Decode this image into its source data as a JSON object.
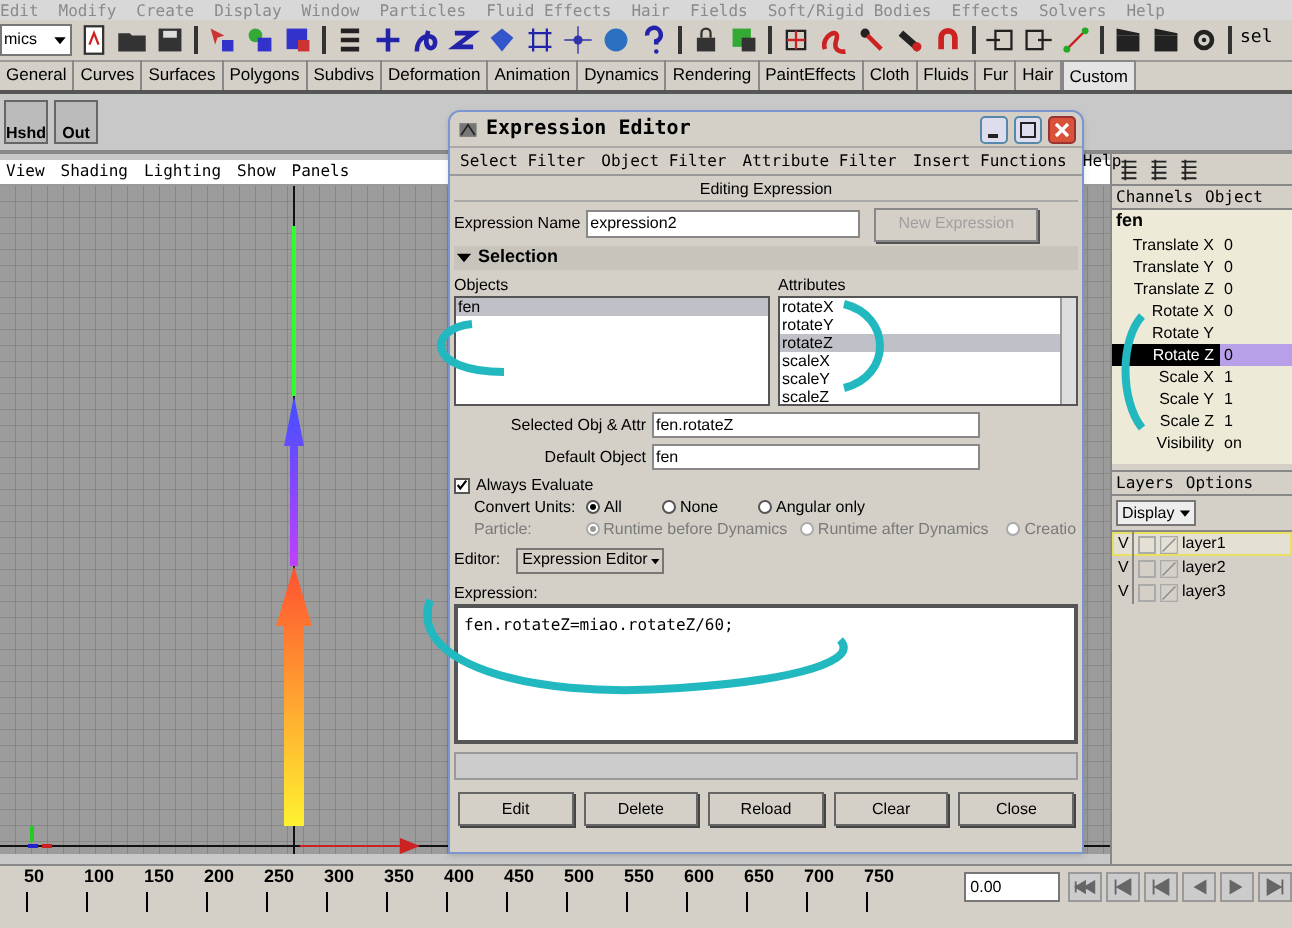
{
  "menu_bar": [
    "Edit",
    "Modify",
    "Create",
    "Display",
    "Window",
    "Particles",
    "Fluid Effects",
    "Hair",
    "Fields",
    "Soft/Rigid Bodies",
    "Effects",
    "Solvers",
    "Help"
  ],
  "toolbar": {
    "mode_dropdown": "mics",
    "selection_label": "sel"
  },
  "shelf": {
    "tabs": [
      {
        "label": "General",
        "selected": false
      },
      {
        "label": "Curves",
        "selected": false
      },
      {
        "label": "Surfaces",
        "selected": false
      },
      {
        "label": "Polygons",
        "selected": false
      },
      {
        "label": "Subdivs",
        "selected": false
      },
      {
        "label": "Deformation",
        "selected": false
      },
      {
        "label": "Animation",
        "selected": false
      },
      {
        "label": "Dynamics",
        "selected": false
      },
      {
        "label": "Rendering",
        "selected": false
      },
      {
        "label": "PaintEffects",
        "selected": false
      },
      {
        "label": "Cloth",
        "selected": false
      },
      {
        "label": "Fluids",
        "selected": false
      },
      {
        "label": "Fur",
        "selected": false
      },
      {
        "label": "Hair",
        "selected": false
      },
      {
        "label": "Custom",
        "selected": true
      }
    ],
    "buttons": [
      "Hshd",
      "Out"
    ]
  },
  "viewport": {
    "menu": [
      "View",
      "Shading",
      "Lighting",
      "Show",
      "Panels"
    ]
  },
  "timeline": {
    "ticks": [
      "50",
      "100",
      "150",
      "200",
      "250",
      "300",
      "350",
      "400",
      "450",
      "500",
      "550",
      "600",
      "650",
      "700",
      "750"
    ],
    "current_frame": "0.00"
  },
  "expression_editor": {
    "title": "Expression Editor",
    "menu": [
      "Select Filter",
      "Object Filter",
      "Attribute Filter",
      "Insert Functions",
      "Help"
    ],
    "heading": "Editing Expression",
    "name_label": "Expression Name",
    "name_value": "expression2",
    "new_button": {
      "label": "New Expression",
      "disabled": true
    },
    "section": {
      "label": "Selection",
      "expanded": true
    },
    "objects": {
      "label": "Objects",
      "items": [
        {
          "label": "fen",
          "selected": true
        }
      ]
    },
    "attributes": {
      "label": "Attributes",
      "items": [
        {
          "label": "rotateX",
          "selected": false
        },
        {
          "label": "rotateY",
          "selected": false
        },
        {
          "label": "rotateZ",
          "selected": true
        },
        {
          "label": "scaleX",
          "selected": false
        },
        {
          "label": "scaleY",
          "selected": false
        },
        {
          "label": "scaleZ",
          "selected": false
        }
      ]
    },
    "selected_label": "Selected Obj & Attr",
    "selected_value": "fen.rotateZ",
    "default_label": "Default Object",
    "default_value": "fen",
    "always_evaluate": {
      "label": "Always Evaluate",
      "checked": true
    },
    "convert_units": {
      "label": "Convert Units:",
      "disabled": false,
      "options": [
        {
          "label": "All",
          "selected": true
        },
        {
          "label": "None",
          "selected": false
        },
        {
          "label": "Angular only",
          "selected": false
        }
      ]
    },
    "particle": {
      "label": "Particle:",
      "disabled": true,
      "options": [
        {
          "label": "Runtime before Dynamics",
          "selected": true
        },
        {
          "label": "Runtime after Dynamics",
          "selected": false
        },
        {
          "label": "Creatio",
          "selected": false
        }
      ]
    },
    "editor_label": "Editor:",
    "editor_value": "Expression Editor",
    "expression_label": "Expression:",
    "expression": "fen.rotateZ=miao.rotateZ/60;",
    "buttons": [
      "Edit",
      "Delete",
      "Reload",
      "Clear",
      "Close"
    ]
  },
  "channel_box": {
    "tabs": [
      "Channels",
      "Object"
    ],
    "object": "fen",
    "channels": [
      {
        "name": "Translate X",
        "value": "0",
        "selected": false,
        "connected": false
      },
      {
        "name": "Translate Y",
        "value": "0",
        "selected": false,
        "connected": false
      },
      {
        "name": "Translate Z",
        "value": "0",
        "selected": false,
        "connected": false
      },
      {
        "name": "Rotate X",
        "value": "0",
        "selected": false,
        "connected": false
      },
      {
        "name": "Rotate Y",
        "selected": false,
        "connected": false
      },
      {
        "name": "Rotate Z",
        "value": "0",
        "selected": true,
        "connected": true
      },
      {
        "name": "Scale X",
        "value": "1",
        "selected": false,
        "connected": false
      },
      {
        "name": "Scale Y",
        "value": "1",
        "selected": false,
        "connected": false
      },
      {
        "name": "Scale Z",
        "value": "1",
        "selected": false,
        "connected": false
      },
      {
        "name": "Visibility",
        "value": "on",
        "selected": false,
        "connected": false
      }
    ]
  },
  "layers": {
    "tabs": [
      "Layers",
      "Options"
    ],
    "dropdown": "Display",
    "items": [
      {
        "visibility": "V",
        "name": "layer1",
        "selected": true
      },
      {
        "visibility": "V",
        "name": "layer2",
        "selected": false
      },
      {
        "visibility": "V",
        "name": "layer3",
        "selected": false
      }
    ]
  }
}
